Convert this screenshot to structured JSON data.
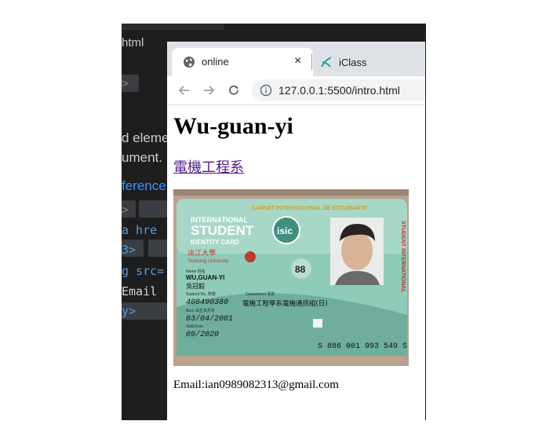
{
  "editor": {
    "file_label": "html",
    "lines": [
      "d eleme",
      "ument.",
      "ference",
      "a hre",
      "3>",
      "g src=",
      "Email",
      "y>"
    ]
  },
  "browser": {
    "tabs": [
      {
        "label": "online",
        "icon": "globe-icon",
        "active": true
      },
      {
        "label": "iClass",
        "icon": "iclass-icon",
        "active": false
      }
    ],
    "tab_close": "×",
    "url": "127.0.0.1:5500/intro.html"
  },
  "page": {
    "heading": "Wu-guan-yi",
    "department_link": "電機工程系",
    "email": "Email:ian0989082313@gmail.com"
  },
  "card": {
    "header_spanish": "CARNET INTERNACIONAL DE ESTUDIANTE",
    "international": "INTERNATIONAL",
    "student": "STUDENT",
    "identity_card": "IDENTITY CARD",
    "isic": "isic",
    "university_cn": "淡江大學",
    "university_en": "Tamkang University",
    "name_label": "Name 姓名",
    "name": "WU,GUAN-YI",
    "name_cn": "吳冠毅",
    "badge_number": "88",
    "student_no_label": "Student No. 學號",
    "student_no": "408490380",
    "department_label": "Department 系別",
    "department": "電機工程學系電機通訊組(日)",
    "born_label": "Born 出生日月年",
    "born": "03/04/2001",
    "valid_label": "Valid from",
    "valid": "09/2020",
    "card_number": "S 886 001 993 549 S",
    "side_text": "STUDENT INTERNATIONAL",
    "colors": {
      "card": "#7fbfae",
      "accent": "#c0392b"
    }
  }
}
